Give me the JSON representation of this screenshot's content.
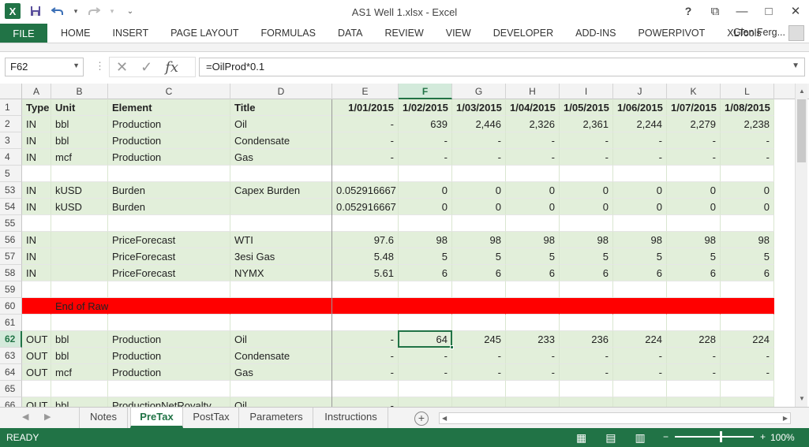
{
  "window": {
    "title": "AS1 Well 1.xlsx - Excel",
    "logo": "X",
    "help": "?",
    "minimize": "—",
    "restore": "□",
    "close": "✕",
    "ribbon_display": "⧉"
  },
  "qat": {
    "save": "💾",
    "undo": "↶",
    "redo": "↷",
    "customize": "⌄"
  },
  "ribbon": {
    "file": "FILE",
    "tabs": [
      "HOME",
      "INSERT",
      "PAGE LAYOUT",
      "FORMULAS",
      "DATA",
      "REVIEW",
      "VIEW",
      "DEVELOPER",
      "ADD-INS",
      "POWERPIVOT",
      "XLTools"
    ],
    "user": "Glen Ferg..."
  },
  "formula_bar": {
    "name_box": "F62",
    "cancel": "✕",
    "enter": "✓",
    "fx": "fx",
    "formula": "=OilProd*0.1"
  },
  "columns": [
    "A",
    "B",
    "C",
    "D",
    "E",
    "F",
    "G",
    "H",
    "I",
    "J",
    "K",
    "L"
  ],
  "selected_column": "F",
  "selected_row": "62",
  "rows": [
    {
      "num": "1",
      "bg": "green",
      "cells": [
        "Type",
        "Unit",
        "Element",
        "Title",
        "1/01/2015",
        "1/02/2015",
        "1/03/2015",
        "1/04/2015",
        "1/05/2015",
        "1/06/2015",
        "1/07/2015",
        "1/08/2015"
      ],
      "bold": true
    },
    {
      "num": "2",
      "bg": "green",
      "cells": [
        "IN",
        "bbl",
        "Production",
        "Oil",
        "-",
        "639",
        "2,446",
        "2,326",
        "2,361",
        "2,244",
        "2,279",
        "2,238"
      ]
    },
    {
      "num": "3",
      "bg": "green",
      "cells": [
        "IN",
        "bbl",
        "Production",
        "Condensate",
        "-",
        "-",
        "-",
        "-",
        "-",
        "-",
        "-",
        "-"
      ]
    },
    {
      "num": "4",
      "bg": "green",
      "cells": [
        "IN",
        "mcf",
        "Production",
        "Gas",
        "-",
        "-",
        "-",
        "-",
        "-",
        "-",
        "-",
        "-"
      ]
    },
    {
      "num": "5",
      "bg": "white",
      "cells": [
        "",
        "",
        "",
        "",
        "",
        "",
        "",
        "",
        "",
        "",
        "",
        ""
      ]
    },
    {
      "num": "53",
      "bg": "green",
      "cells": [
        "IN",
        "kUSD",
        "Burden",
        "Capex Burden",
        "0.052916667",
        "0",
        "0",
        "0",
        "0",
        "0",
        "0",
        "0"
      ]
    },
    {
      "num": "54",
      "bg": "green",
      "cells": [
        "IN",
        "kUSD",
        "Burden",
        "",
        "0.052916667",
        "0",
        "0",
        "0",
        "0",
        "0",
        "0",
        "0"
      ]
    },
    {
      "num": "55",
      "bg": "white",
      "cells": [
        "",
        "",
        "",
        "",
        "",
        "",
        "",
        "",
        "",
        "",
        "",
        ""
      ]
    },
    {
      "num": "56",
      "bg": "green",
      "cells": [
        "IN",
        "",
        "PriceForecast",
        "WTI",
        "97.6",
        "98",
        "98",
        "98",
        "98",
        "98",
        "98",
        "98"
      ]
    },
    {
      "num": "57",
      "bg": "green",
      "cells": [
        "IN",
        "",
        "PriceForecast",
        "3esi Gas",
        "5.48",
        "5",
        "5",
        "5",
        "5",
        "5",
        "5",
        "5"
      ]
    },
    {
      "num": "58",
      "bg": "green",
      "cells": [
        "IN",
        "",
        "PriceForecast",
        "NYMX",
        "5.61",
        "6",
        "6",
        "6",
        "6",
        "6",
        "6",
        "6"
      ]
    },
    {
      "num": "59",
      "bg": "white",
      "cells": [
        "",
        "",
        "",
        "",
        "",
        "",
        "",
        "",
        "",
        "",
        "",
        ""
      ]
    },
    {
      "num": "60",
      "bg": "red",
      "cells": [
        "",
        "End of Raw Inputs",
        "",
        "",
        "",
        "",
        "",
        "",
        "",
        "",
        "",
        ""
      ]
    },
    {
      "num": "61",
      "bg": "white",
      "cells": [
        "",
        "",
        "",
        "",
        "",
        "",
        "",
        "",
        "",
        "",
        "",
        ""
      ]
    },
    {
      "num": "62",
      "bg": "green",
      "cells": [
        "OUT",
        "bbl",
        "Production",
        "Oil",
        "-",
        "64",
        "245",
        "233",
        "236",
        "224",
        "228",
        "224"
      ]
    },
    {
      "num": "63",
      "bg": "green",
      "cells": [
        "OUT",
        "bbl",
        "Production",
        "Condensate",
        "-",
        "-",
        "-",
        "-",
        "-",
        "-",
        "-",
        "-"
      ]
    },
    {
      "num": "64",
      "bg": "green",
      "cells": [
        "OUT",
        "mcf",
        "Production",
        "Gas",
        "-",
        "-",
        "-",
        "-",
        "-",
        "-",
        "-",
        "-"
      ]
    },
    {
      "num": "65",
      "bg": "white",
      "cells": [
        "",
        "",
        "",
        "",
        "",
        "",
        "",
        "",
        "",
        "",
        "",
        ""
      ]
    },
    {
      "num": "66",
      "bg": "green",
      "cells": [
        "OUT",
        "bbl",
        "ProductionNetRoyalty",
        "Oil",
        "-",
        "",
        "",
        "",
        "",
        "",
        "",
        ""
      ]
    }
  ],
  "sheet_tabs": [
    "Notes",
    "PreTax",
    "PostTax",
    "Parameters",
    "Instructions"
  ],
  "active_sheet": "PreTax",
  "tab_nav": {
    "prev": "◀",
    "next": "▶"
  },
  "add_sheet": "+",
  "status": {
    "ready": "READY",
    "zoom_out": "−",
    "zoom_in": "+",
    "zoom": "100%",
    "view_normal": "▦",
    "view_layout": "▤",
    "view_break": "▥"
  },
  "colors": {
    "accent": "#217346",
    "input_fill": "#e2efda",
    "divider_fill": "#ff0000"
  }
}
